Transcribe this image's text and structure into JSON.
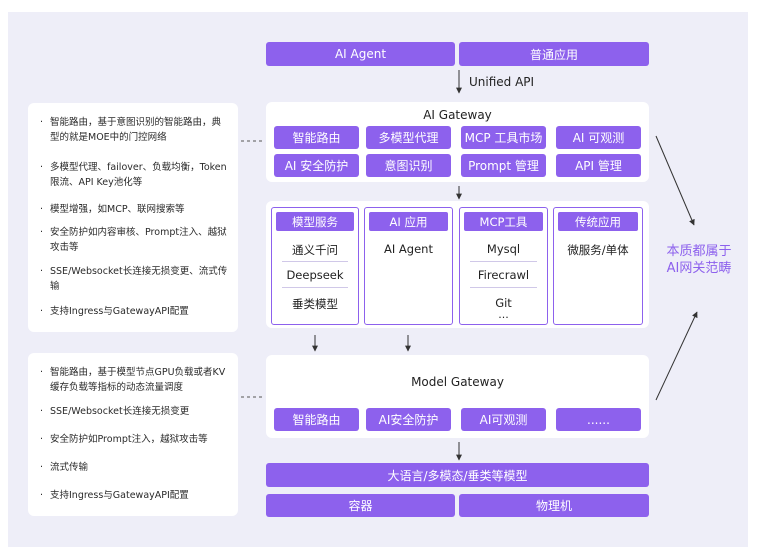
{
  "top": {
    "ai_agent": "AI Agent",
    "common_app": "普通应用"
  },
  "unified_api": "Unified API",
  "ai_gateway": {
    "title": "AI Gateway",
    "row1": [
      "智能路由",
      "多模型代理",
      "MCP 工具市场",
      "AI 可观测"
    ],
    "row2": [
      "AI 安全防护",
      "意图识别",
      "Prompt 管理",
      "API 管理"
    ]
  },
  "services": [
    {
      "head": "模型服务",
      "items": [
        "通义千问",
        "Deepseek",
        "垂类模型"
      ]
    },
    {
      "head": "AI 应用",
      "items": [
        "AI Agent"
      ]
    },
    {
      "head": "MCP工具",
      "items": [
        "Mysql",
        "Firecrawl",
        "Git",
        "..."
      ]
    },
    {
      "head": "传统应用",
      "items": [
        "微服务/单体"
      ]
    }
  ],
  "model_gateway": {
    "title": "Model Gateway",
    "items": [
      "智能路由",
      "AI安全防护",
      "AI可观测",
      "......"
    ]
  },
  "bottom": {
    "models": "大语言/多模态/垂类等模型",
    "container": "容器",
    "physical": "物理机"
  },
  "side_label": [
    "本质都属于",
    "AI网关范畴"
  ],
  "notes_top": [
    "智能路由，基于意图识别的智能路由，典型的就是MOE中的门控网络",
    "多模型代理、failover、负载均衡，Token限流、API Key池化等",
    "模型增强，如MCP、联网搜索等",
    "安全防护如内容审核、Prompt注入、越狱攻击等",
    "SSE/Websocket长连接无损变更、流式传输",
    "支持Ingress与GatewayAPI配置"
  ],
  "notes_bottom": [
    "智能路由，基于模型节点GPU负载或者KV缓存负载等指标的动态流量调度",
    "SSE/Websocket长连接无损变更",
    "安全防护如Prompt注入，越狱攻击等",
    "流式传输",
    "支持Ingress与GatewayAPI配置"
  ],
  "bullet": "·",
  "colors": {
    "purple": "#8d61ed",
    "bg": "#eeeef8",
    "label": "#8d61ed"
  }
}
